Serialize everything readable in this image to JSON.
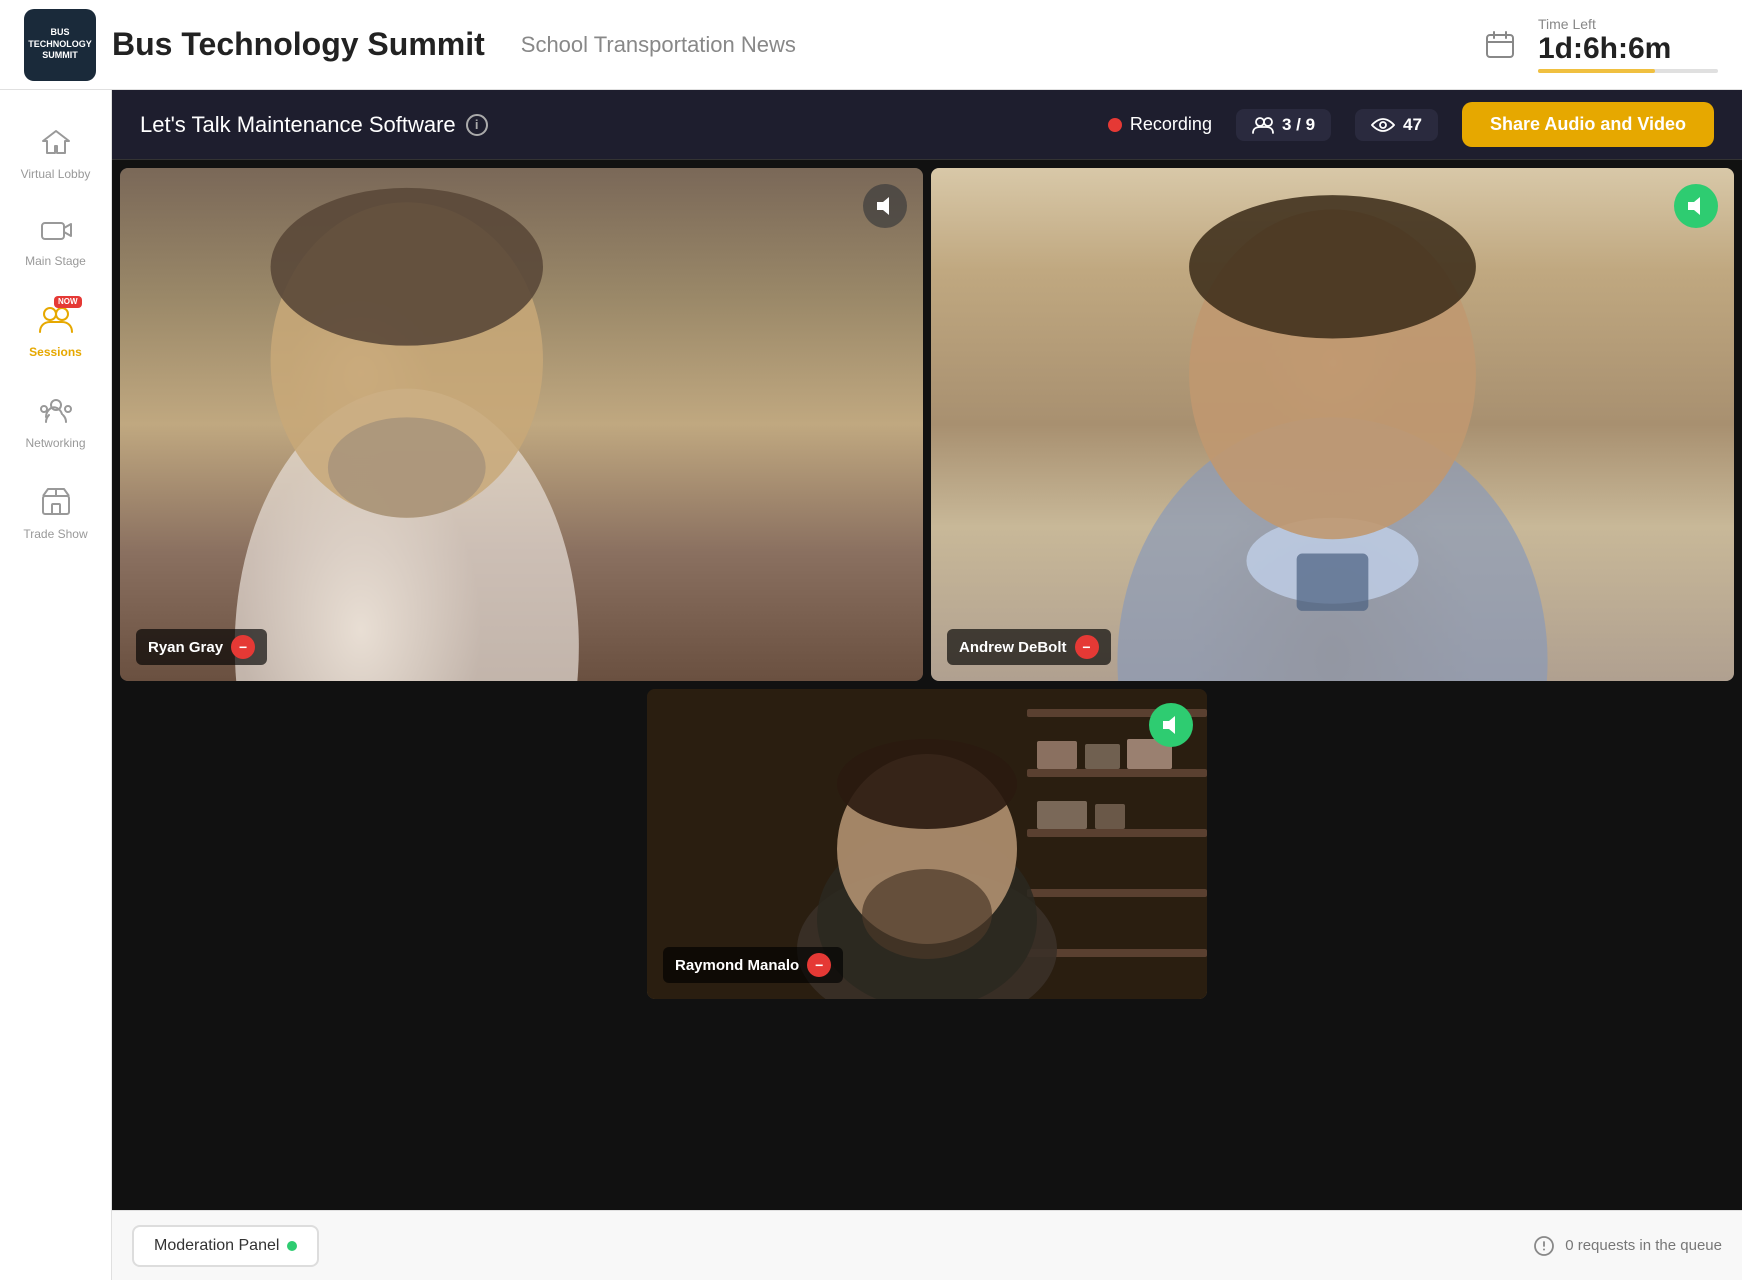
{
  "header": {
    "logo_lines": [
      "BUS",
      "TECHNOLOGY",
      "SUMMIT"
    ],
    "app_title": "Bus Technology Summit",
    "app_subtitle": "School Transportation News",
    "time_left_label": "Time Left",
    "time_left_value": "1d:6h:6m",
    "time_progress_percent": 65
  },
  "sidebar": {
    "items": [
      {
        "id": "virtual-lobby",
        "label": "Virtual Lobby",
        "icon": "🏠",
        "active": false
      },
      {
        "id": "main-stage",
        "label": "Main Stage",
        "icon": "🎥",
        "active": false
      },
      {
        "id": "sessions",
        "label": "Sessions",
        "icon": "👥",
        "active": true,
        "now_badge": "NOW"
      },
      {
        "id": "networking",
        "label": "Networking",
        "icon": "🤝",
        "active": false
      },
      {
        "id": "trade-show",
        "label": "Trade Show",
        "icon": "🏪",
        "active": false
      }
    ]
  },
  "session": {
    "title": "Let's Talk Maintenance Software",
    "info_tooltip": "Info",
    "recording_label": "Recording",
    "attendees_count": "3 / 9",
    "views_count": "47",
    "share_btn_label": "Share Audio and Video"
  },
  "speakers": [
    {
      "id": "ryan-gray",
      "name": "Ryan Gray"
    },
    {
      "id": "andrew-debolt",
      "name": "Andrew DeBolt"
    },
    {
      "id": "raymond-manalo",
      "name": "Raymond Manalo"
    }
  ],
  "bottom_bar": {
    "moderation_panel_label": "Moderation Panel",
    "queue_info": "0 requests in the queue"
  },
  "icons": {
    "home": "⌂",
    "camera": "📷",
    "handshake": "🤝",
    "store": "🏪",
    "speaker": "◀",
    "calendar": "📅",
    "info": "i",
    "minus": "−",
    "eye": "👁",
    "people": "👥"
  }
}
